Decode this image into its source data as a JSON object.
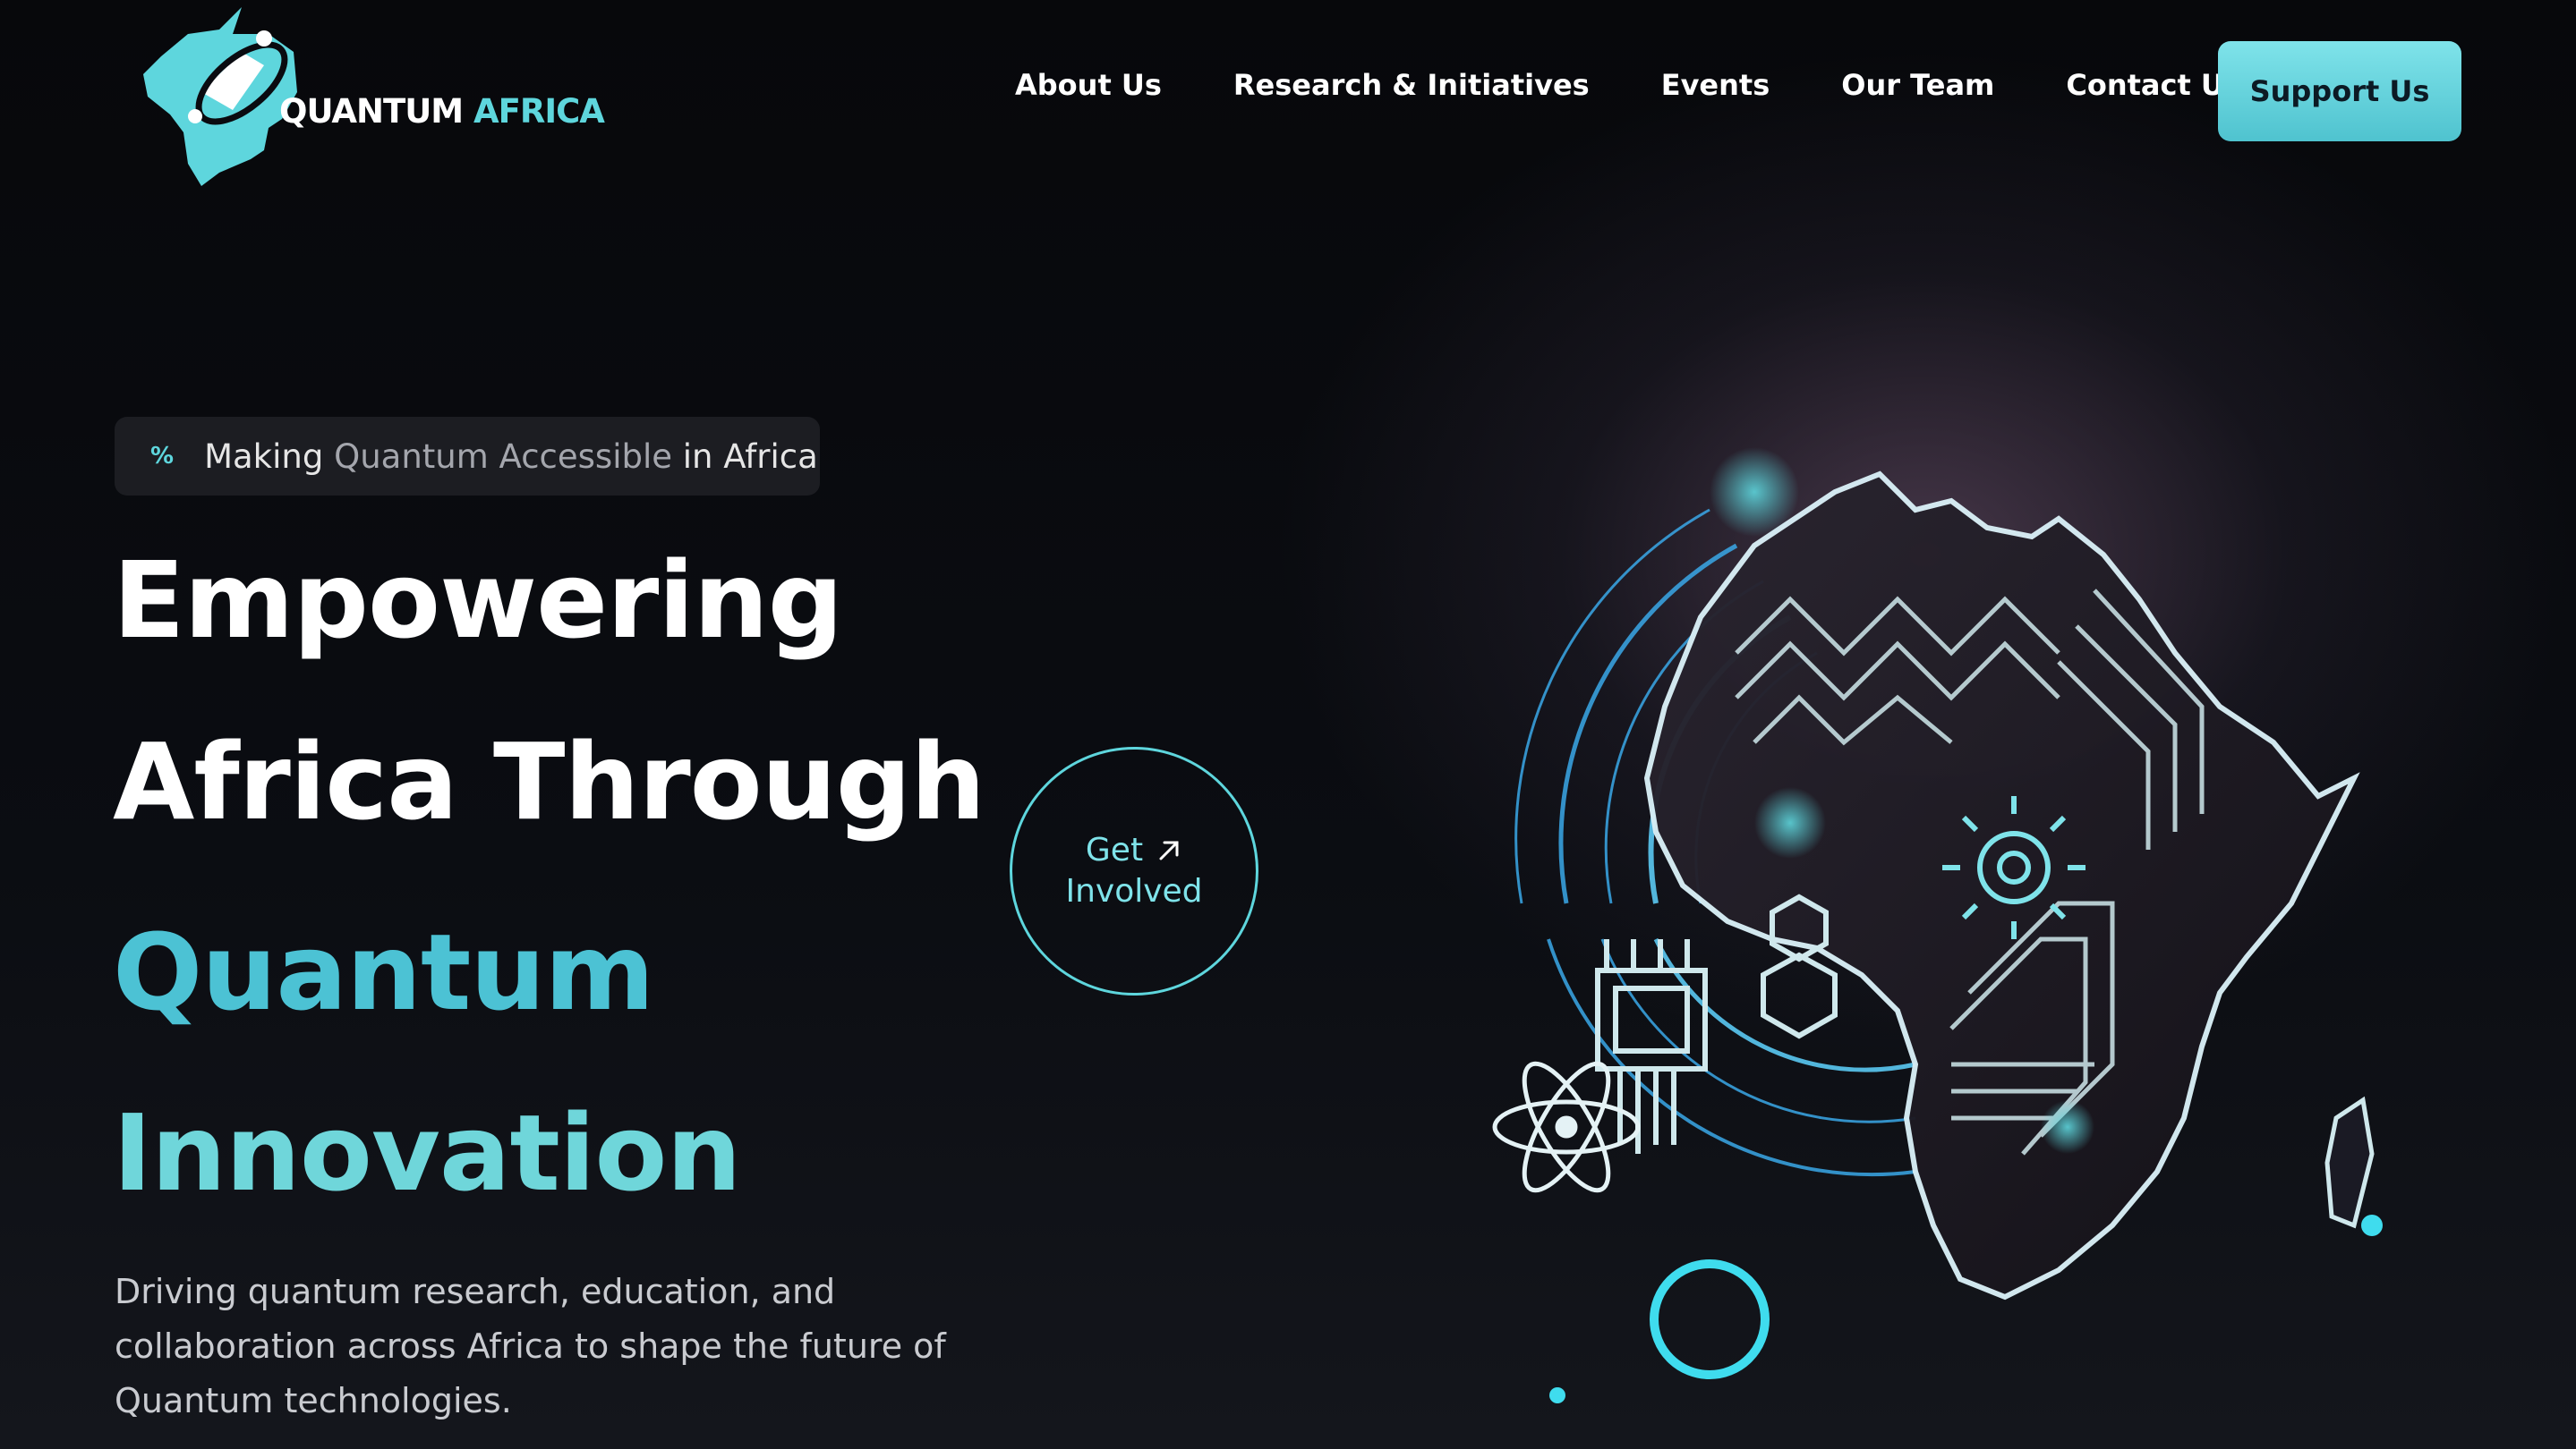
{
  "brand": {
    "name_part1": "QUANTUM",
    "name_part2": "AFRICA",
    "accent_color": "#5ed6dd"
  },
  "nav": {
    "items": [
      {
        "label": "About Us"
      },
      {
        "label": "Research & Initiatives"
      },
      {
        "label": "Events"
      },
      {
        "label": "Our Team"
      },
      {
        "label": "Contact Us"
      }
    ],
    "support_label": "Support Us"
  },
  "hero": {
    "badge": {
      "icon": "percent-icon",
      "part1": "Making",
      "part2": "Quantum Accessible",
      "part3": "in Africa"
    },
    "headline": {
      "line1": "Empowering",
      "line2": "Africa Through",
      "line3": "Quantum",
      "line4": "Innovation"
    },
    "description": "Driving quantum research, education, and collaboration across Africa to shape the future of Quantum technologies.",
    "cta": {
      "line1": "Get",
      "line2": "Involved",
      "icon": "arrow-up-right-icon"
    }
  }
}
